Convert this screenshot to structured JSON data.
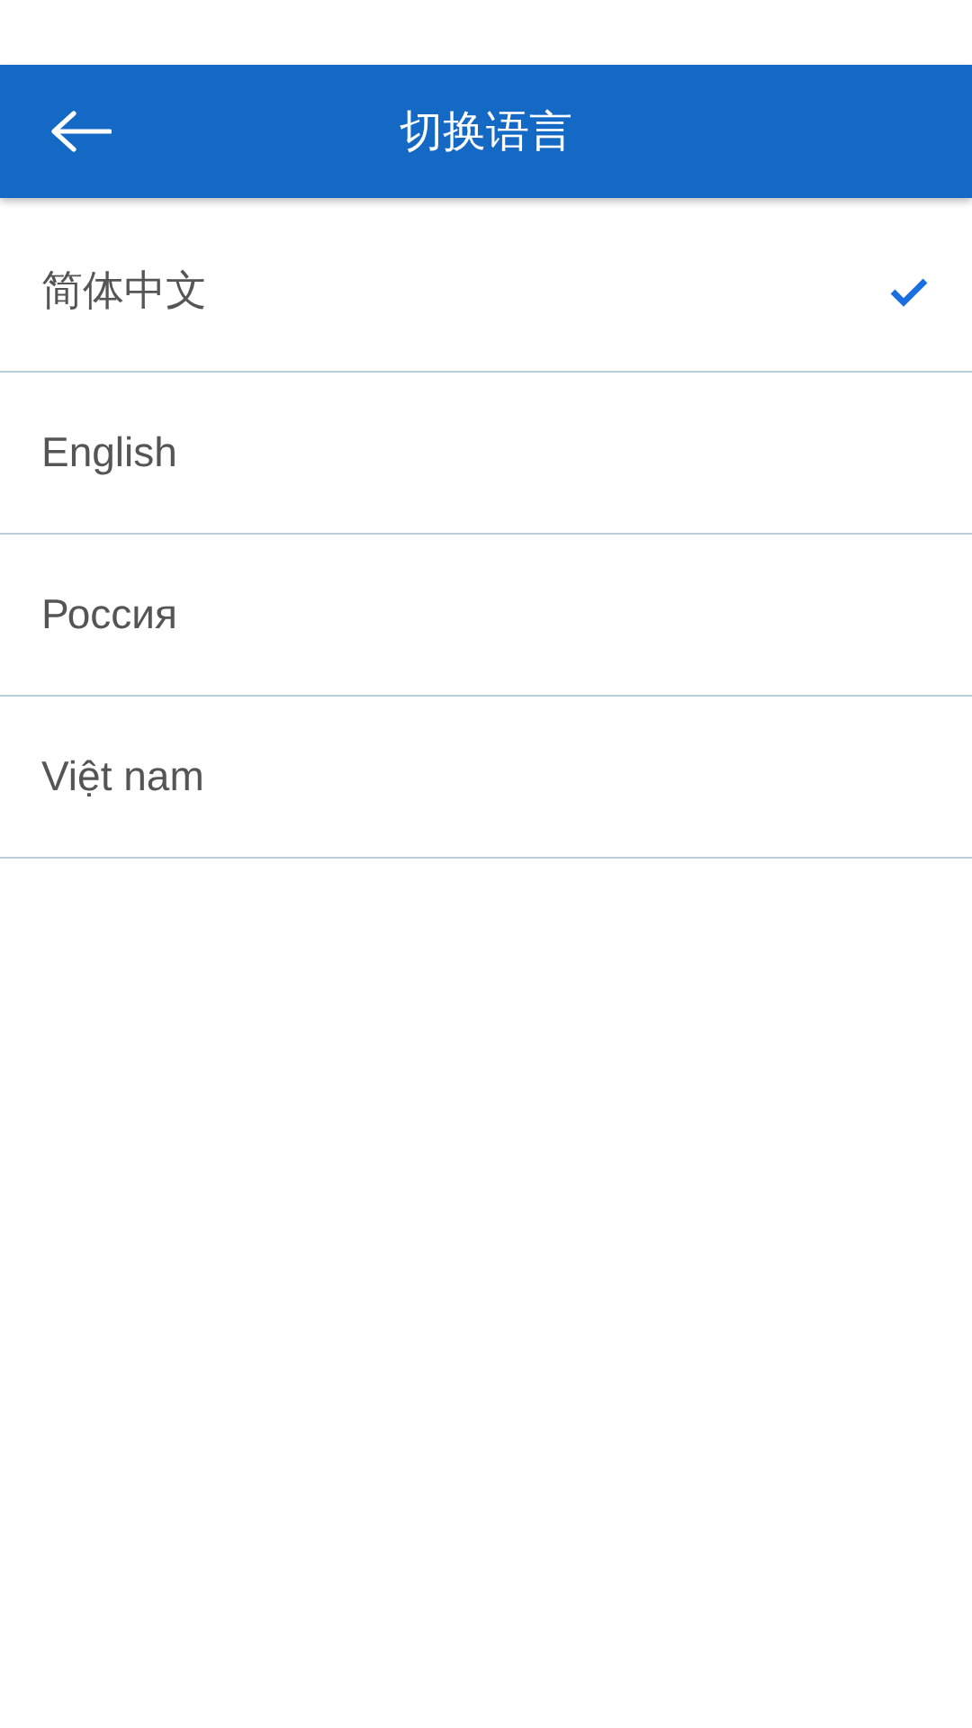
{
  "header": {
    "title": "切换语言"
  },
  "languages": [
    {
      "label": "简体中文",
      "selected": true
    },
    {
      "label": "English",
      "selected": false
    },
    {
      "label": "Россия",
      "selected": false
    },
    {
      "label": "Việt nam",
      "selected": false
    }
  ]
}
